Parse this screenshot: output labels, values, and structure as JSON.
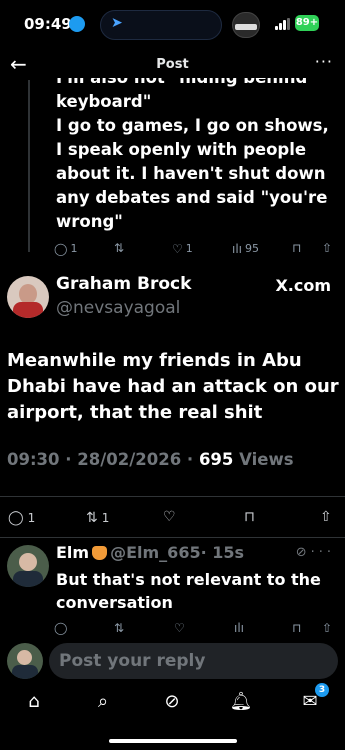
{
  "status_bar": {
    "time": "09:49",
    "battery": "89+"
  },
  "header": {
    "title": "Post",
    "back_icon": "arrow-left-icon",
    "more_icon": "more-icon"
  },
  "previous_reply": {
    "clipped_line": "I'm also not \"hiding behind my",
    "lines": [
      "keyboard\"",
      "I go to games, I go on shows, I speak openly with people about it. I haven't shut down any debates and said \"you're wrong\""
    ],
    "stats": {
      "replies": "1",
      "likes": "1",
      "views": "95"
    }
  },
  "tweet": {
    "name": "Graham Brock",
    "handle": "@nevsayagoal",
    "source": "X.com",
    "text": "Meanwhile my friends in Abu Dhabi have had an attack on our airport, that the real shit",
    "time": "09:30 · 28/02/2026 · ",
    "views_count": "695",
    "views_label": " Views",
    "stats": {
      "replies": "1",
      "reposts": "1"
    }
  },
  "reply": {
    "name": "Elm",
    "handle": "@Elm_665",
    "time": "· 15s",
    "text": "But that's not relevant to the conversation"
  },
  "composer": {
    "placeholder": "Post your reply"
  },
  "nav": {
    "messages_badge": "3"
  },
  "colors": {
    "accent": "#1d9bf0",
    "muted": "#71767b",
    "background": "#000000"
  }
}
